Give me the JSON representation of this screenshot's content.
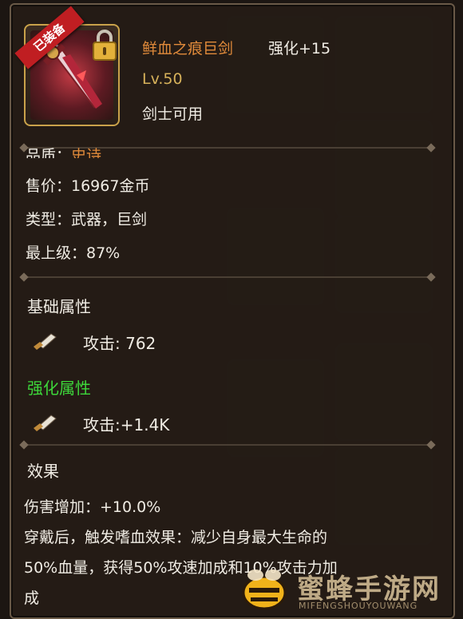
{
  "item": {
    "badge": "已装备",
    "name": "鲜血之痕巨剑",
    "enhance": "强化+15",
    "level": "Lv.50",
    "usable_by": "剑士可用",
    "icon": "sword-icon",
    "lock_icon": "lock-icon"
  },
  "info": {
    "quality_label": "品质：",
    "quality_value": "史诗",
    "price": "售价：16967金币",
    "type": "类型：武器，巨剑",
    "top_rank": "最上级：87%"
  },
  "base_attrs": {
    "title": "基础属性",
    "attack": "攻击: 762"
  },
  "enhance_attrs": {
    "title": "强化属性",
    "attack": "攻击:+1.4K"
  },
  "effect": {
    "title": "效果",
    "line1": "伤害增加：+10.0%",
    "line2": "穿戴后，触发嗜血效果：减少自身最大生命的",
    "line3": "50%血量，获得50%攻速加成和10%攻击力加",
    "line4": "成"
  },
  "watermark": {
    "main": "蜜蜂手游网",
    "sub": "MIFENGSHOUYOUWANG"
  },
  "colors": {
    "orange": "#e08a3a",
    "gold": "#d6b15a",
    "green": "#3dd63a",
    "text": "#f0ece4"
  }
}
